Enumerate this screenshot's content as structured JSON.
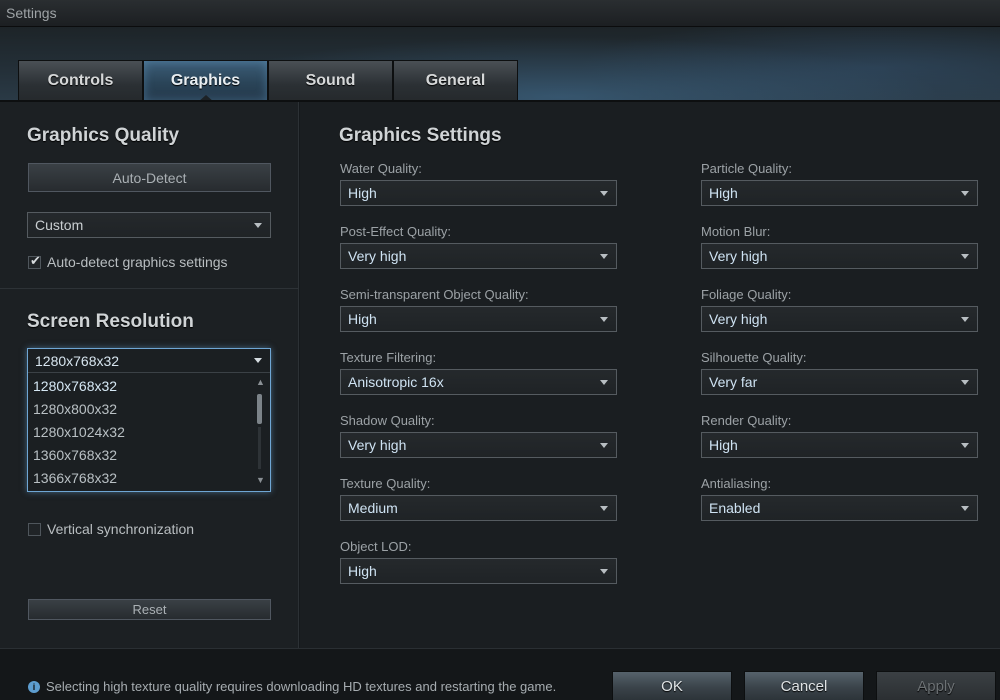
{
  "window": {
    "title": "Settings"
  },
  "tabs": [
    {
      "label": "Controls"
    },
    {
      "label": "Graphics"
    },
    {
      "label": "Sound"
    },
    {
      "label": "General"
    }
  ],
  "left": {
    "quality_heading": "Graphics Quality",
    "autodetect_button": "Auto-Detect",
    "preset_value": "Custom",
    "autodetect_checkbox": {
      "label": "Auto-detect graphics settings",
      "checked": true
    },
    "resolution_heading": "Screen Resolution",
    "resolution": {
      "selected": "1280x768x32",
      "options": [
        "1280x768x32",
        "1280x800x32",
        "1280x1024x32",
        "1360x768x32",
        "1366x768x32"
      ]
    },
    "vsync_checkbox": {
      "label": "Vertical synchronization",
      "checked": false
    },
    "reset_button": "Reset"
  },
  "main": {
    "heading": "Graphics Settings",
    "left_column": [
      {
        "label": "Water Quality:",
        "value": "High"
      },
      {
        "label": "Post-Effect Quality:",
        "value": "Very high"
      },
      {
        "label": "Semi-transparent Object Quality:",
        "value": "High"
      },
      {
        "label": "Texture Filtering:",
        "value": "Anisotropic 16x"
      },
      {
        "label": "Shadow Quality:",
        "value": "Very high"
      },
      {
        "label": "Texture Quality:",
        "value": "Medium"
      },
      {
        "label": "Object LOD:",
        "value": "High"
      }
    ],
    "right_column": [
      {
        "label": "Particle Quality:",
        "value": "High"
      },
      {
        "label": "Motion Blur:",
        "value": "Very high"
      },
      {
        "label": "Foliage Quality:",
        "value": "Very high"
      },
      {
        "label": "Silhouette Quality:",
        "value": "Very far"
      },
      {
        "label": "Render Quality:",
        "value": "High"
      },
      {
        "label": "Antialiasing:",
        "value": "Enabled"
      }
    ]
  },
  "footer": {
    "info_text": "Selecting high texture quality requires downloading HD textures and restarting the game.",
    "ok_label": "OK",
    "cancel_label": "Cancel",
    "apply_label": "Apply"
  },
  "colors": {
    "accent": "#6fa6d4",
    "background": "#1a1e21"
  }
}
